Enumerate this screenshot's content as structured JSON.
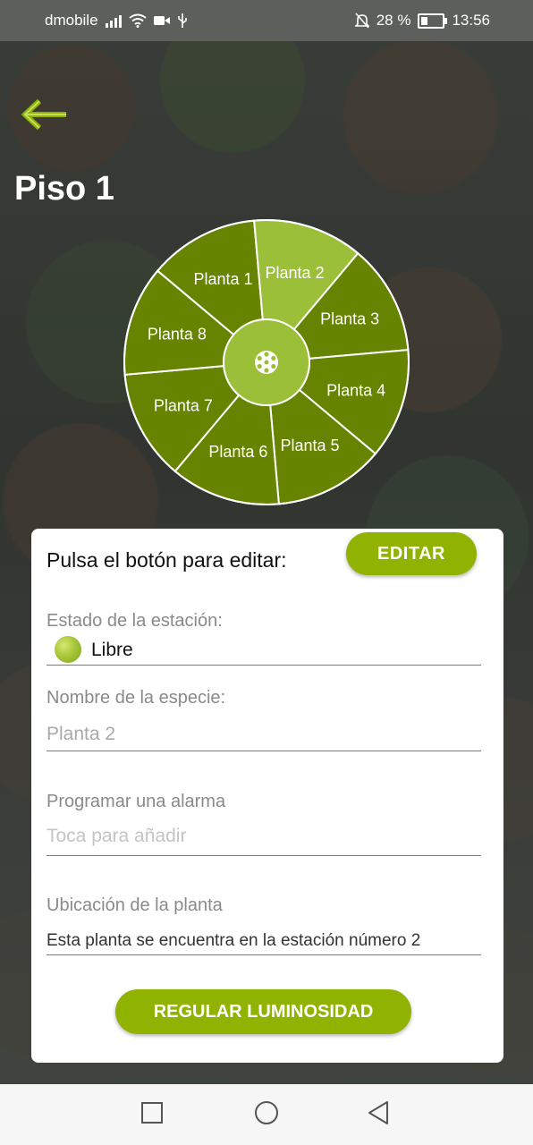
{
  "status_bar": {
    "carrier": "dmobile",
    "battery_percent": "28 %",
    "time": "13:56",
    "icons": [
      "signal-icon",
      "wifi-icon",
      "video-icon",
      "usb-icon",
      "mute-bell-icon",
      "battery-charging-icon"
    ]
  },
  "header": {
    "back_icon": "arrow-left-icon",
    "title": "Piso 1"
  },
  "wheel": {
    "center_icon": "settings-compass-icon",
    "selected": "Planta 2",
    "segments": [
      {
        "label": "Planta 1",
        "color": "#668400"
      },
      {
        "label": "Planta 2",
        "color": "#9cbf3a"
      },
      {
        "label": "Planta 3",
        "color": "#668400"
      },
      {
        "label": "Planta 4",
        "color": "#668400"
      },
      {
        "label": "Planta 5",
        "color": "#668400"
      },
      {
        "label": "Planta 6",
        "color": "#668400"
      },
      {
        "label": "Planta 7",
        "color": "#668400"
      },
      {
        "label": "Planta 8",
        "color": "#668400"
      }
    ],
    "center_color": "#9cbf3a"
  },
  "card": {
    "prompt": "Pulsa el botón para editar:",
    "edit_label": "EDITAR",
    "status_label": "Estado de la estación:",
    "status_value": "Libre",
    "species_label": "Nombre de la especie:",
    "species_value": "Planta 2",
    "alarm_label": "Programar una alarma",
    "alarm_placeholder": "Toca para añadir",
    "location_label": "Ubicación de la planta",
    "location_value": "Esta planta se encuentra en la estación número 2",
    "light_button_label": "REGULAR LUMINOSIDAD"
  },
  "nav_bar": {
    "icons": [
      "recent-apps-icon",
      "home-icon",
      "back-triangle-icon"
    ]
  },
  "colors": {
    "accent": "#8fb300",
    "segment_dark": "#668400",
    "segment_selected": "#9cbf3a"
  }
}
